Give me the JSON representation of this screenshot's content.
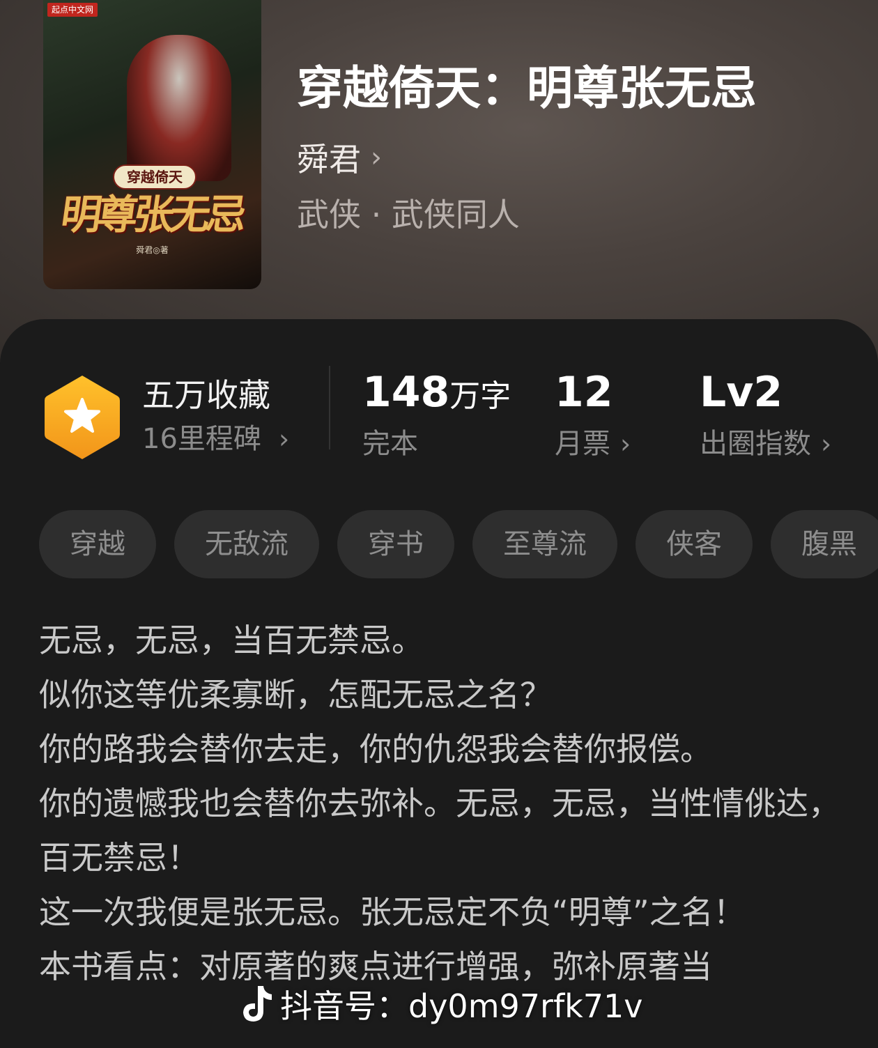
{
  "book": {
    "title": "穿越倚天：明尊张无忌",
    "author": "舜君",
    "genre": "武侠 · 武侠同人",
    "cover": {
      "publisher": "起点中文网",
      "subtitle": "穿越倚天",
      "title_art": "明尊张无忌",
      "author_line": "舜君◎著"
    }
  },
  "stats": {
    "favorites": {
      "label": "五万收藏",
      "milestone": "16里程碑"
    },
    "words": {
      "value": "148",
      "unit": "万字",
      "label": "完本"
    },
    "monthly_votes": {
      "value": "12",
      "label": "月票"
    },
    "influence": {
      "value": "Lv2",
      "label": "出圈指数"
    }
  },
  "tags": [
    "穿越",
    "无敌流",
    "穿书",
    "至尊流",
    "侠客",
    "腹黑"
  ],
  "description": [
    "无忌，无忌，当百无禁忌。",
    "似你这等优柔寡断，怎配无忌之名？",
    "你的路我会替你去走，你的仇怨我会替你报偿。",
    "你的遗憾我也会替你去弥补。无忌，无忌，当性情佻达，百无禁忌！",
    "这一次我便是张无忌。张无忌定不负“明尊”之名！",
    "本书看点：对原著的爽点进行增强，弥补原著当"
  ],
  "watermark": "抖音号：dy0m97rfk71v",
  "colors": {
    "badge": "#F5A623",
    "panel_bg": "#1b1b1b",
    "tag_bg": "#2e2e2e",
    "secondary_text": "#8c8c8c"
  }
}
